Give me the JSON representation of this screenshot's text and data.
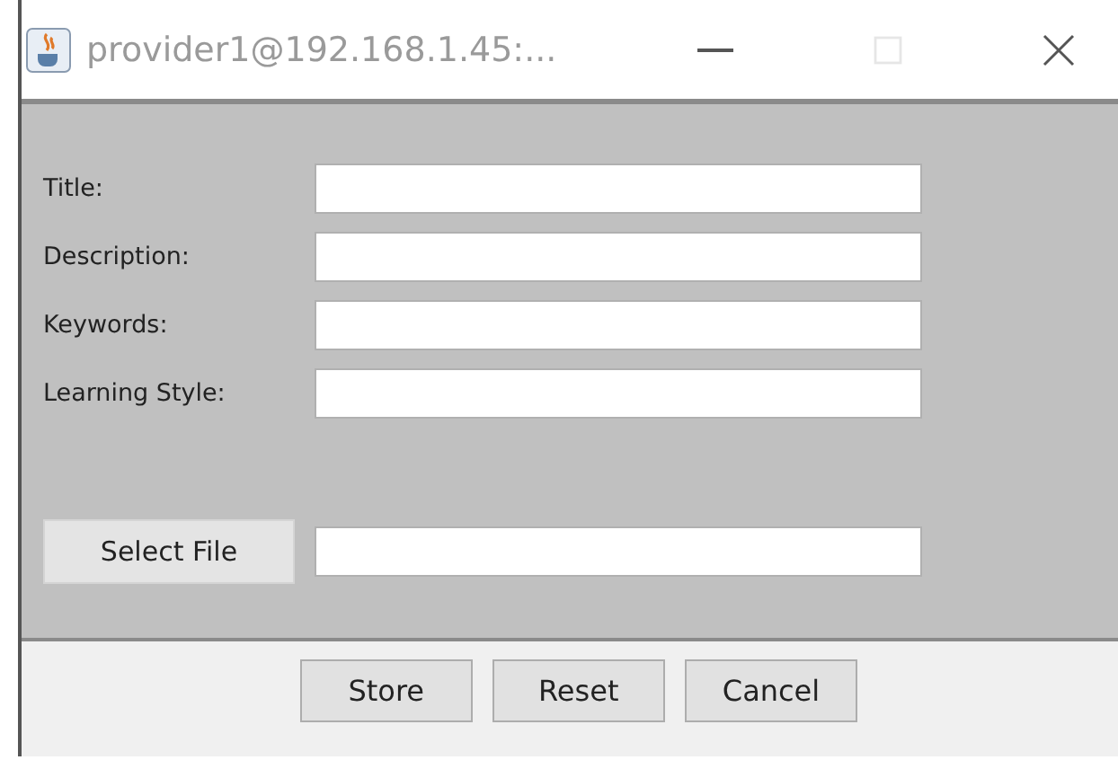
{
  "window": {
    "title": "provider1@192.168.1.45:...",
    "maximize_disabled": true
  },
  "form": {
    "fields": [
      {
        "label": "Title:"
      },
      {
        "label": "Description:"
      },
      {
        "label": "Keywords:"
      },
      {
        "label": "Learning Style:"
      }
    ],
    "file_button": "Select File"
  },
  "buttons": [
    "Store",
    "Reset",
    "Cancel"
  ]
}
